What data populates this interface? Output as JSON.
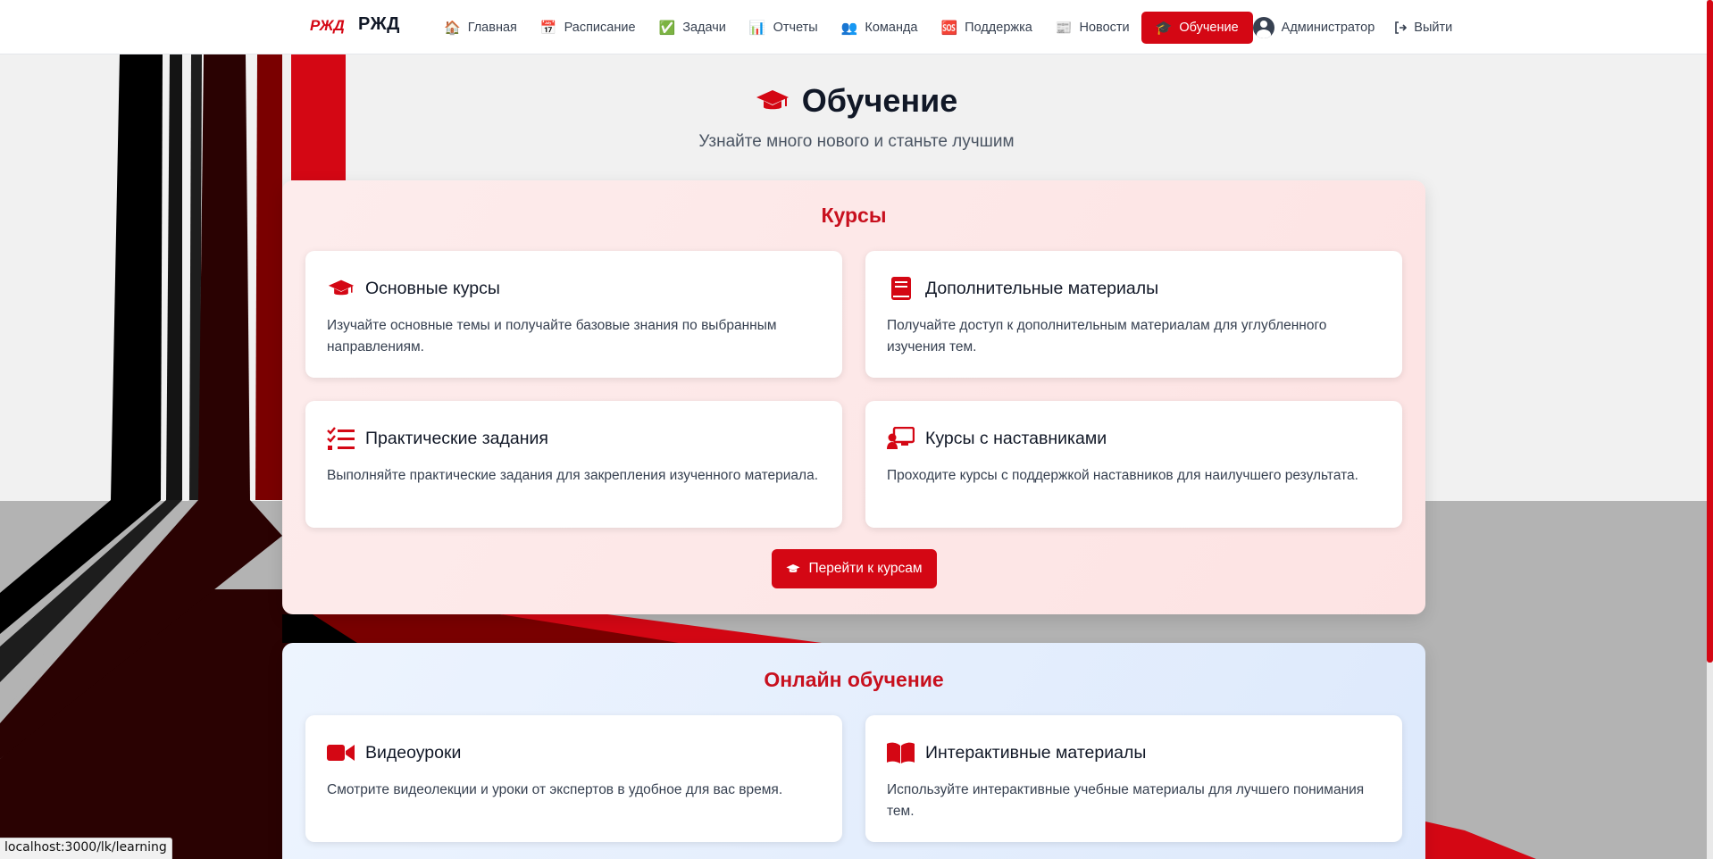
{
  "brand": {
    "logo_text": "РЖД",
    "name": "РЖД"
  },
  "nav": {
    "items": [
      {
        "label": "Главная",
        "icon": "house-icon",
        "glyph": "🏠"
      },
      {
        "label": "Расписание",
        "icon": "calendar-icon",
        "glyph": "📅"
      },
      {
        "label": "Задачи",
        "icon": "check-icon",
        "glyph": "✅"
      },
      {
        "label": "Отчеты",
        "icon": "bar-chart-icon",
        "glyph": "📊"
      },
      {
        "label": "Команда",
        "icon": "team-icon",
        "glyph": "👥"
      },
      {
        "label": "Поддержка",
        "icon": "sos-icon",
        "glyph": "🆘"
      },
      {
        "label": "Новости",
        "icon": "newspaper-icon",
        "glyph": "📰"
      },
      {
        "label": "Обучение",
        "icon": "graduation-cap-icon",
        "glyph": "🎓",
        "active": true
      }
    ],
    "user": "Администратор",
    "logout": "Выйти"
  },
  "header": {
    "title": "Обучение",
    "subtitle": "Узнайте много нового и станьте лучшим"
  },
  "courses": {
    "title": "Курсы",
    "cards": [
      {
        "icon": "graduation-cap-icon",
        "title": "Основные курсы",
        "desc": "Изучайте основные темы и получайте базовые знания по выбранным направлениям."
      },
      {
        "icon": "book-icon",
        "title": "Дополнительные материалы",
        "desc": "Получайте доступ к дополнительным материалам для углубленного изучения тем."
      },
      {
        "icon": "task-list-icon",
        "title": "Практические задания",
        "desc": "Выполняйте практические задания для закрепления изученного материала."
      },
      {
        "icon": "mentor-icon",
        "title": "Курсы с наставниками",
        "desc": "Проходите курсы с поддержкой наставников для наилучшего результата."
      }
    ],
    "button": "Перейти к курсам"
  },
  "online": {
    "title": "Онлайн обучение",
    "cards": [
      {
        "icon": "video-icon",
        "title": "Видеоуроки",
        "desc": "Смотрите видеолекции и уроки от экспертов в удобное для вас время."
      },
      {
        "icon": "open-book-icon",
        "title": "Интерактивные материалы",
        "desc": "Используйте интерактивные учебные материалы для лучшего понимания тем."
      }
    ]
  },
  "status_url": "localhost:3000/lk/learning",
  "colors": {
    "accent": "#d40714",
    "section_title": "#c8101e"
  }
}
